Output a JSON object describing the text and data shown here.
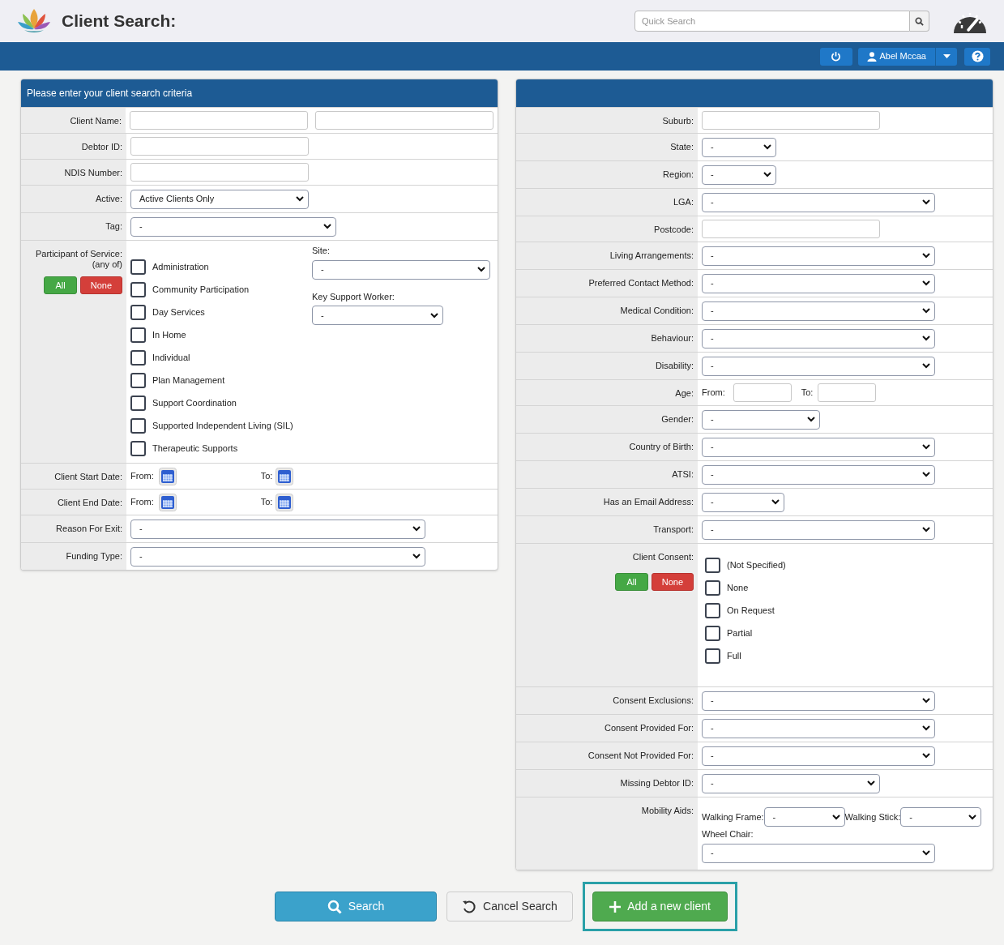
{
  "header": {
    "title": "Client Search:",
    "quick_search": {
      "placeholder": "Quick Search"
    }
  },
  "toolbar": {
    "user": "Abel Mccaa"
  },
  "left_panel": {
    "title": "Please enter your client search criteria",
    "rows": [
      {
        "kind": "text2",
        "label": "Client Name:"
      },
      {
        "kind": "text",
        "label": "Debtor ID:"
      },
      {
        "kind": "text",
        "label": "NDIS Number:"
      },
      {
        "kind": "select",
        "label": "Active:",
        "value": "Active Clients Only"
      },
      {
        "kind": "select",
        "label": "Tag:",
        "value": "-"
      },
      {
        "kind": "services",
        "label": "Participant of Service:",
        "sublabel": "(any of)",
        "all_button": "All",
        "none_button": "None",
        "options": [
          {
            "label": "Administration",
            "checked": false
          },
          {
            "label": "Community Participation",
            "checked": false
          },
          {
            "label": "Day Services",
            "checked": false
          },
          {
            "label": "In Home",
            "checked": false
          },
          {
            "label": "Individual",
            "checked": false
          },
          {
            "label": "Plan Management",
            "checked": false
          },
          {
            "label": "Support Coordination",
            "checked": false
          },
          {
            "label": "Supported Independent Living (SIL)",
            "checked": false
          },
          {
            "label": "Therapeutic Supports",
            "checked": false
          }
        ],
        "site": {
          "label": "Site:",
          "value": "-"
        },
        "key_worker": {
          "label": "Key Support Worker:",
          "value": "-"
        }
      },
      {
        "kind": "daterange",
        "label": "Client Start Date:",
        "from": "From:",
        "to": "To:"
      },
      {
        "kind": "daterange",
        "label": "Client End Date:",
        "from": "From:",
        "to": "To:"
      },
      {
        "kind": "select",
        "label": "Reason For Exit:",
        "value": "-"
      },
      {
        "kind": "select",
        "label": "Funding Type:",
        "value": "-"
      }
    ]
  },
  "right_panel": {
    "rows": [
      {
        "kind": "text",
        "label": "Suburb:"
      },
      {
        "kind": "select",
        "label": "State:",
        "value": "-"
      },
      {
        "kind": "select",
        "label": "Region:",
        "value": "-"
      },
      {
        "kind": "select",
        "label": "LGA:",
        "value": "-"
      },
      {
        "kind": "text",
        "label": "Postcode:"
      },
      {
        "kind": "select",
        "label": "Living Arrangements:",
        "value": "-"
      },
      {
        "kind": "select",
        "label": "Preferred Contact Method:",
        "value": "-"
      },
      {
        "kind": "select",
        "label": "Medical Condition:",
        "value": "-"
      },
      {
        "kind": "select",
        "label": "Behaviour:",
        "value": "-"
      },
      {
        "kind": "select",
        "label": "Disability:",
        "value": "-"
      },
      {
        "kind": "age",
        "label": "Age:",
        "from": "From:",
        "to": "To:"
      },
      {
        "kind": "select",
        "label": "Gender:",
        "value": "-"
      },
      {
        "kind": "select",
        "label": "Country of Birth:",
        "value": "-"
      },
      {
        "kind": "select",
        "label": "ATSI:",
        "value": "-"
      },
      {
        "kind": "select",
        "label": "Has an Email Address:",
        "value": "-"
      },
      {
        "kind": "select",
        "label": "Transport:",
        "value": "-"
      },
      {
        "kind": "consent",
        "label": "Client Consent:",
        "all_button": "All",
        "none_button": "None",
        "options": [
          {
            "label": "(Not Specified)",
            "checked": false
          },
          {
            "label": "None",
            "checked": false
          },
          {
            "label": "On Request",
            "checked": false
          },
          {
            "label": "Partial",
            "checked": false
          },
          {
            "label": "Full",
            "checked": false
          }
        ]
      },
      {
        "kind": "select",
        "label": "Consent Exclusions:",
        "value": "-"
      },
      {
        "kind": "select",
        "label": "Consent Provided For:",
        "value": "-"
      },
      {
        "kind": "select",
        "label": "Consent Not Provided For:",
        "value": "-"
      },
      {
        "kind": "select",
        "label": "Missing Debtor ID:",
        "value": "-"
      },
      {
        "kind": "mobility",
        "label": "Mobility Aids:",
        "walking_frame": {
          "label": "Walking Frame:",
          "value": "-"
        },
        "walking_stick": {
          "label": "Walking Stick:",
          "value": "-"
        },
        "wheel_chair": {
          "label": "Wheel Chair:",
          "value": "-"
        }
      }
    ]
  },
  "actions": [
    {
      "kind": "search",
      "label": "Search"
    },
    {
      "kind": "cancel",
      "label": "Cancel Search"
    },
    {
      "kind": "add",
      "label": "Add a new client",
      "highlighted": true
    }
  ]
}
